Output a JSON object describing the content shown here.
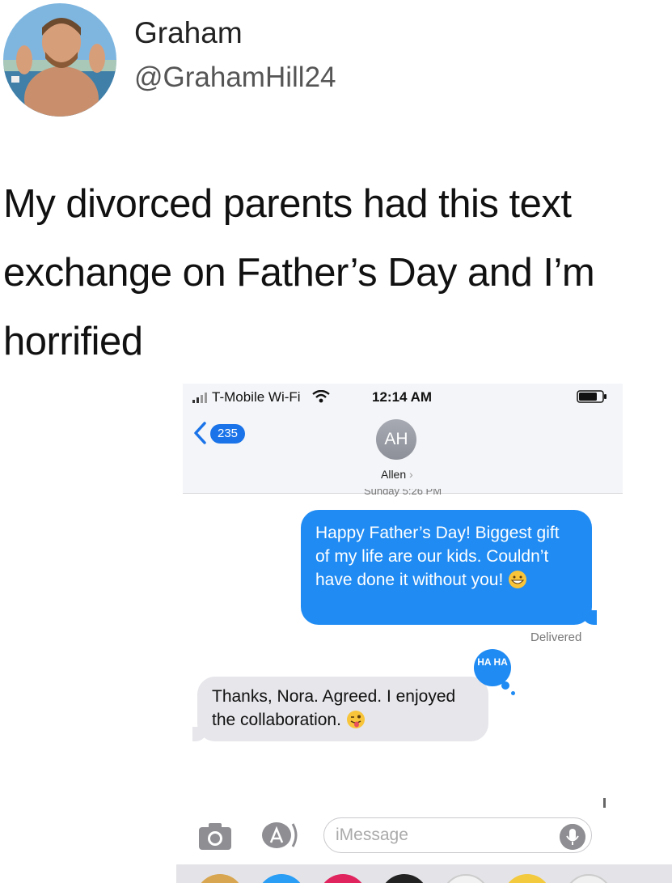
{
  "tweet": {
    "author_name": "Graham",
    "author_handle": "@GrahamHill24",
    "text": "My divorced parents had this text exchange on  Father’s Day and I’m horrified"
  },
  "phone": {
    "status_bar": {
      "carrier": "T-Mobile Wi-Fi",
      "time": "12:14 AM"
    },
    "nav": {
      "back_count": "235",
      "contact_initials": "AH",
      "contact_name": "Allen",
      "contact_chevron": "›"
    },
    "date_label": "Sunday 5:26 PM",
    "messages": [
      {
        "direction": "sent",
        "text": "Happy Father’s Day! Biggest gift of my life are our kids. Couldn’t have done it without you!",
        "emoji": "grinning-face-icon"
      },
      {
        "direction": "received",
        "text": "Thanks, Nora. Agreed. I enjoyed the collaboration.",
        "emoji": "winking-face-with-tongue-icon"
      }
    ],
    "delivered_label": "Delivered",
    "tapback_label": "HA HA",
    "input_placeholder": "iMessage",
    "colors": {
      "imessage_blue": "#1f8bf3",
      "received_gray": "#e6e6eb",
      "badge_blue": "#1a73e8"
    }
  }
}
